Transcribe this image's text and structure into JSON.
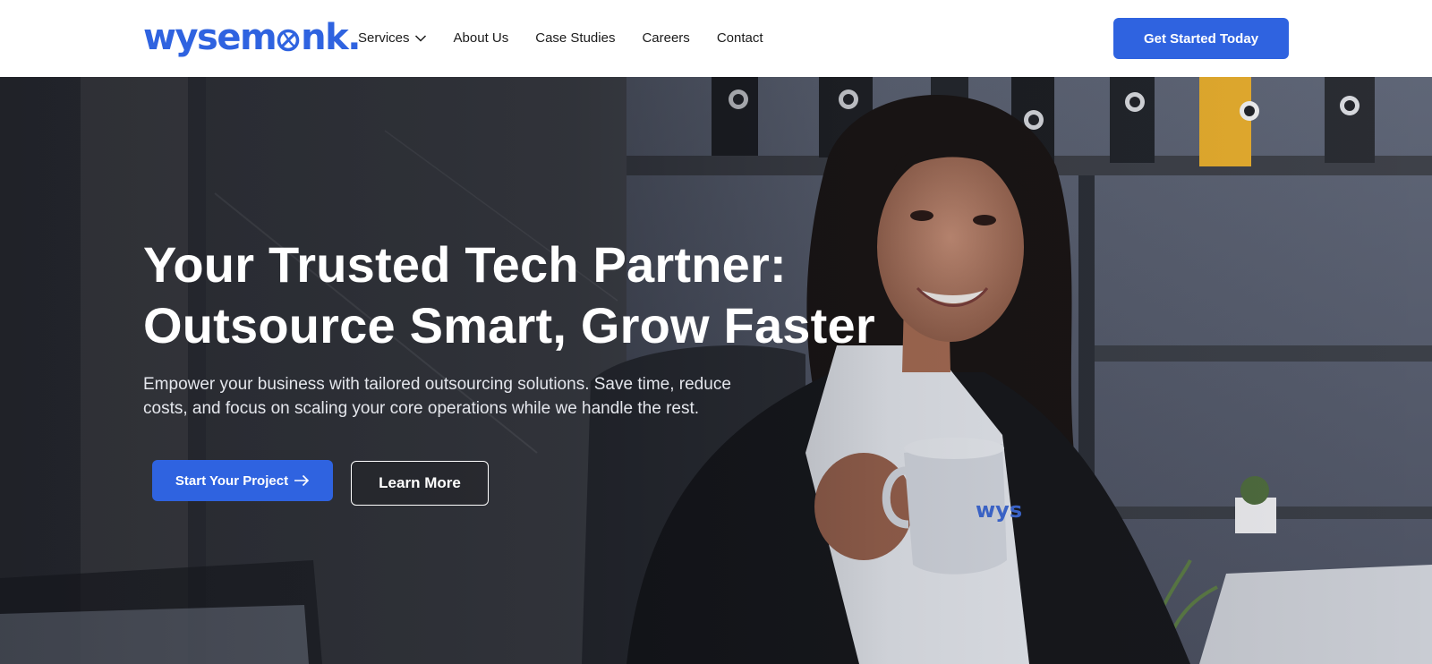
{
  "brand": {
    "name": "wysemonk",
    "color": "#2f63e0"
  },
  "nav": {
    "items": [
      {
        "label": "Services",
        "has_dropdown": true
      },
      {
        "label": "About Us"
      },
      {
        "label": "Case Studies"
      },
      {
        "label": "Careers"
      },
      {
        "label": "Contact"
      }
    ],
    "cta_label": "Get Started Today"
  },
  "hero": {
    "title_line1": "Your Trusted Tech Partner:",
    "title_line2": "Outsource Smart, Grow Faster",
    "subtitle_line1": "Empower your business with tailored outsourcing solutions. Save time, reduce",
    "subtitle_line2": "costs, and focus on scaling your core operations while we handle the rest.",
    "primary_button": "Start Your Project",
    "secondary_button": "Learn More",
    "mug_text": "wys"
  },
  "icons": {
    "dropdown": "chevron-down-icon",
    "arrow": "arrow-right-icon"
  }
}
